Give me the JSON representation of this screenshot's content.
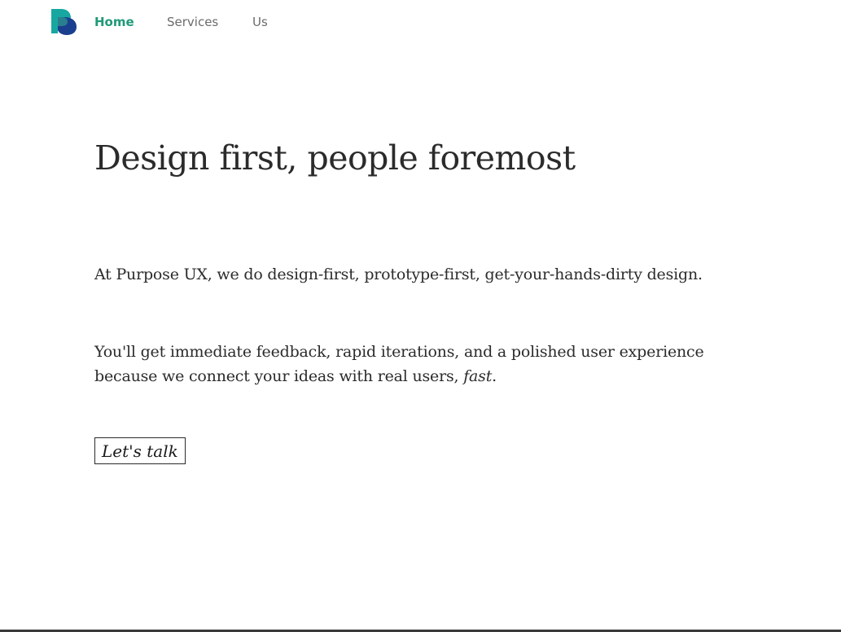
{
  "nav": {
    "logo_label": "Purpose UX logo",
    "items": [
      {
        "label": "Home",
        "active": true
      },
      {
        "label": "Services",
        "active": false
      },
      {
        "label": "Us",
        "active": false
      }
    ]
  },
  "hero": {
    "title": "Design first, people foremost"
  },
  "intro": {
    "paragraph1": "At Purpose UX, we do design-first, prototype-first, get-your-hands-dirty design.",
    "paragraph2_main": "You'll get immediate feedback, rapid iterations, and a polished user experience because we connect your ideas with real users, ",
    "paragraph2_emphasis": "fast",
    "paragraph2_end": "."
  },
  "cta": {
    "label": "Let's talk"
  },
  "colors": {
    "accent": "#1f9a78",
    "logo_teal": "#17a7a0",
    "logo_navy": "#1b3f8f",
    "text": "#2b2b2b",
    "nav_text": "#6b6b6b"
  }
}
